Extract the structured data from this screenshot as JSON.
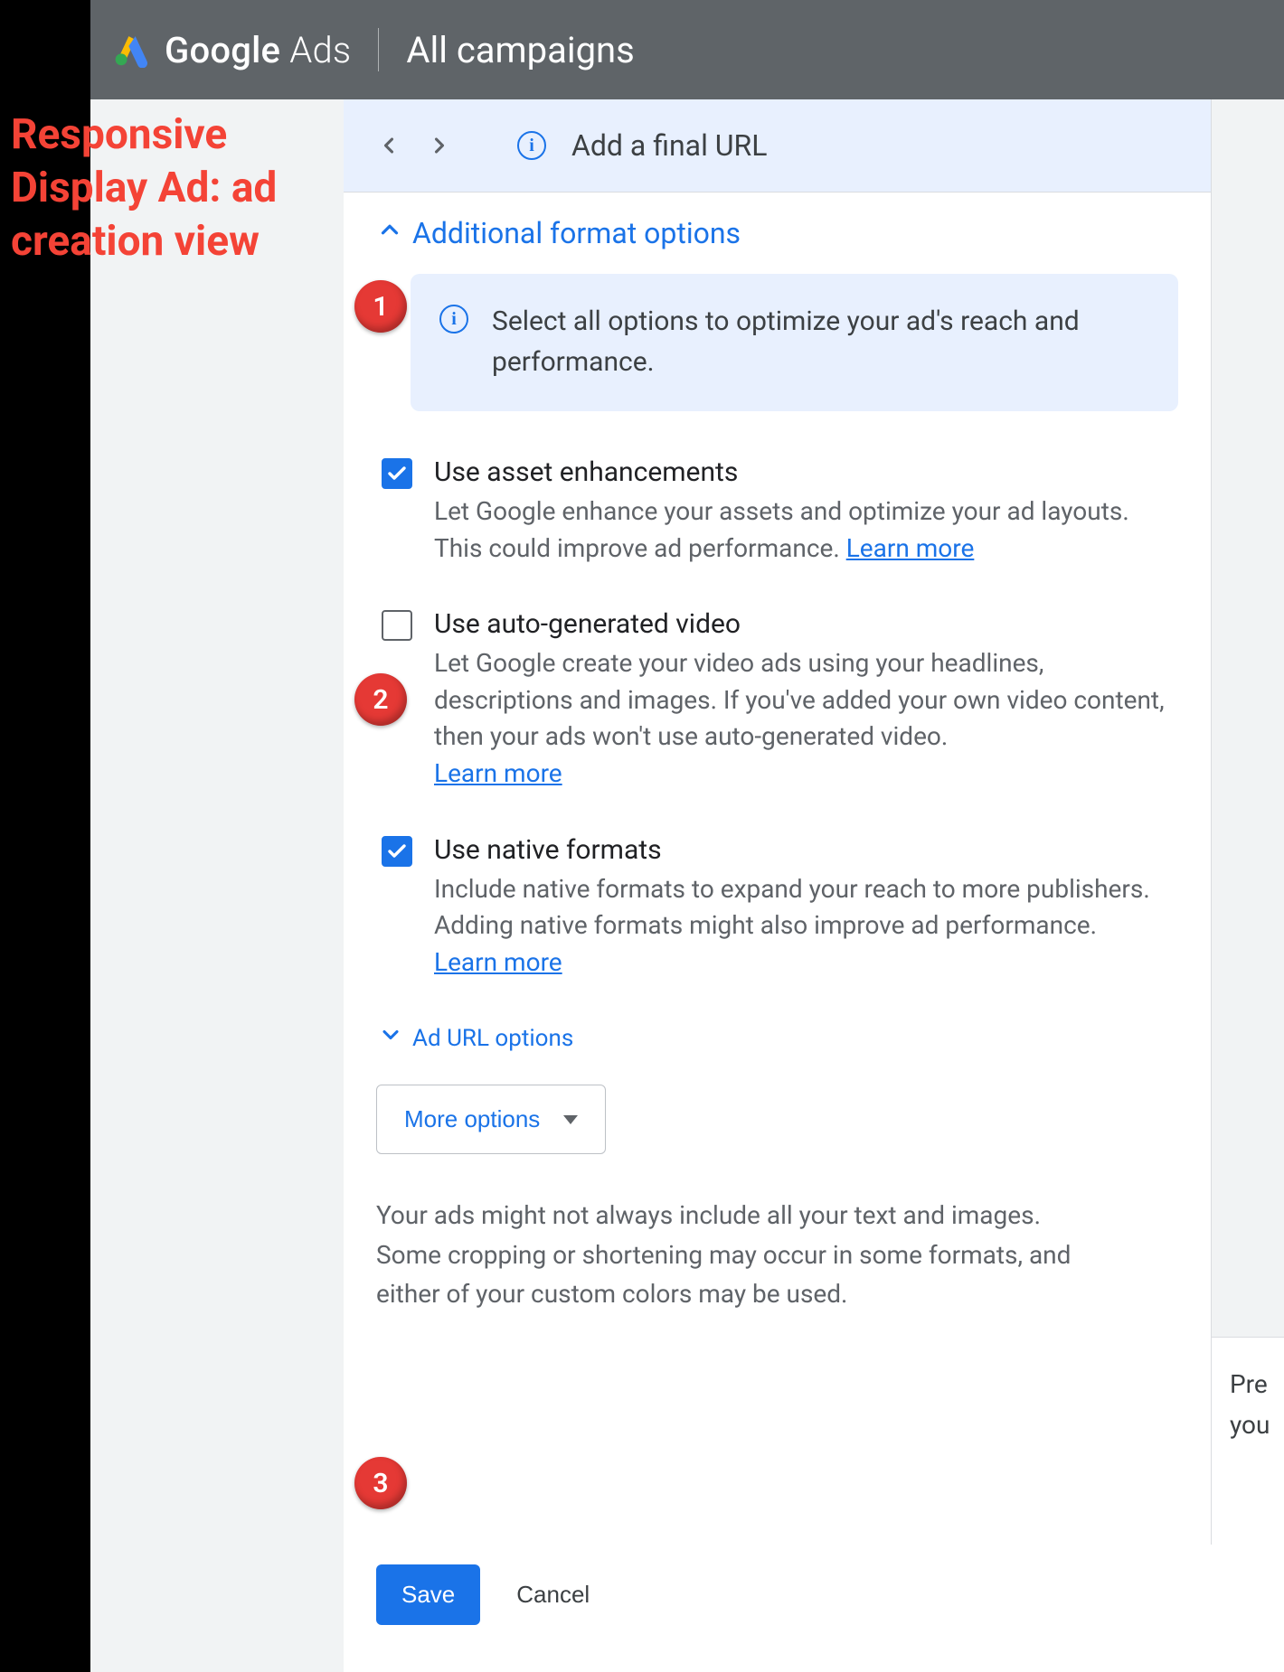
{
  "header": {
    "product_name_strong": "Google",
    "product_name_light": "Ads",
    "scope": "All campaigns"
  },
  "infobar": {
    "message": "Add a final URL"
  },
  "section": {
    "title": "Additional format options",
    "notice": "Select all options to optimize your ad's reach and performance.",
    "options": [
      {
        "checked": true,
        "title": "Use asset enhancements",
        "desc1": "Let Google enhance your assets and optimize your ad layouts. This could improve ad performance. ",
        "learn_more": "Learn more",
        "desc2": ""
      },
      {
        "checked": false,
        "title": "Use auto-generated video",
        "desc1": "Let Google create your video ads using your headlines, descriptions and images. If you've added your own video content, then your ads won't use auto-generated video.",
        "learn_more": "Learn more",
        "desc2": ""
      },
      {
        "checked": true,
        "title": "Use native formats",
        "desc1": "Include native formats to expand your reach to more publishers. Adding native formats might also improve ad performance.",
        "learn_more": "Learn more",
        "desc2": ""
      }
    ],
    "sub_toggle": "Ad URL options",
    "more_options": "More options",
    "disclaimer": "Your ads might not always include all your text and images. Some cropping or shortening may occur in some formats, and either of your custom colors may be used."
  },
  "actions": {
    "save": "Save",
    "cancel": "Cancel"
  },
  "right_sliver": {
    "line1": "Pre",
    "line2": "you"
  },
  "annotations": {
    "title": "Responsive Display Ad: ad creation view",
    "badges": [
      "1",
      "2",
      "3"
    ]
  },
  "colors": {
    "primary": "#1a73e8",
    "danger": "#e53935",
    "header": "#5f6468",
    "notice_bg": "#e8f0fe",
    "text": "#3c4043",
    "muted": "#5f6368"
  }
}
